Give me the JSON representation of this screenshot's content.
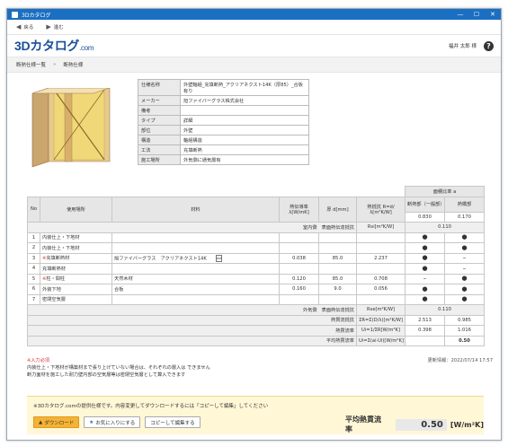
{
  "window": {
    "title": "3Dカタログ",
    "minimize": "—",
    "maximize": "☐",
    "close": "✕"
  },
  "toolbar": {
    "back": "戻る",
    "forward": "進む"
  },
  "header": {
    "logo": "3Dカタログ",
    "logo_suffix": ".com",
    "user": "福井 太郎 様",
    "help": "?"
  },
  "breadcrumb": {
    "item1": "断熱仕様一覧",
    "separator": "»",
    "item2": "断熱仕様"
  },
  "spec": [
    {
      "key": "仕様名称",
      "value": "外壁軸組_充填断熱_アクリアネクスト14K（厚85）_合板有り"
    },
    {
      "key": "メーカー",
      "value": "旭ファイバーグラス株式会社"
    },
    {
      "key": "備考",
      "value": ""
    },
    {
      "key": "タイプ",
      "value": "詳細"
    },
    {
      "key": "部位",
      "value": "外壁"
    },
    {
      "key": "構造",
      "value": "軸組構造"
    },
    {
      "key": "工法",
      "value": "充填断熱"
    },
    {
      "key": "施工場所",
      "value": "外気側に通気層有"
    }
  ],
  "table": {
    "head": {
      "ratio_group": "面積比率 a",
      "no": "No",
      "location": "使用場所",
      "material": "材料",
      "conductivity": "熱伝導率 λ[W/mK]",
      "thickness": "厚 d[mm]",
      "resistance": "熱抵抗 R=d/λ[m²K/W]",
      "part_a": "断熱部（一般部）",
      "part_b": "熱橋部",
      "ratio_a": "0.830",
      "ratio_b": "0.170"
    },
    "indoor": {
      "label": "室内側　表面熱伝達抵抗",
      "symbol": "Rsi[m²K/W]",
      "value": "0.110"
    },
    "rows": [
      {
        "no": "1",
        "mark": "",
        "loc": "内装仕上・下地材",
        "mat": "",
        "pdf": "",
        "lam": "",
        "d": "",
        "r": "",
        "a": "●",
        "b": "●"
      },
      {
        "no": "2",
        "mark": "",
        "loc": "内装仕上・下地材",
        "mat": "",
        "pdf": "",
        "lam": "",
        "d": "",
        "r": "",
        "a": "●",
        "b": "●"
      },
      {
        "no": "3",
        "mark": "※",
        "loc": "充填断熱材",
        "mat": "旭ファイバーグラス　アクリアネクスト14K",
        "pdf": "PDF",
        "lam": "0.038",
        "d": "85.0",
        "r": "2.237",
        "a": "●",
        "b": "–"
      },
      {
        "no": "4",
        "mark": "",
        "loc": "充填断熱材",
        "mat": "",
        "pdf": "",
        "lam": "",
        "d": "",
        "r": "",
        "a": "●",
        "b": "–"
      },
      {
        "no": "5",
        "mark": "※",
        "loc": "柱・間柱",
        "mat": "天然木材",
        "pdf": "",
        "lam": "0.120",
        "d": "85.0",
        "r": "0.708",
        "a": "–",
        "b": "●"
      },
      {
        "no": "6",
        "mark": "",
        "loc": "外装下地",
        "mat": "合板",
        "pdf": "",
        "lam": "0.160",
        "d": "9.0",
        "r": "0.056",
        "a": "●",
        "b": "●"
      },
      {
        "no": "7",
        "mark": "",
        "loc": "密閉空気層",
        "mat": "",
        "pdf": "",
        "lam": "",
        "d": "",
        "r": "",
        "a": "●",
        "b": "●"
      }
    ],
    "outdoor": {
      "label": "外気側　表面熱伝達抵抗",
      "symbol": "Rse[m²K/W]",
      "value": "0.110"
    },
    "totals": [
      {
        "label": "熱貫流抵抗",
        "symbol": "ΣR=Σ(D/λ)[m²K/W]",
        "a": "2.513",
        "b": "0.985"
      },
      {
        "label": "熱貫流率",
        "symbol": "Ui=1/ΣR[W/m²K]",
        "a": "0.398",
        "b": "1.016"
      },
      {
        "label": "平均熱貫流率",
        "symbol": "Ui=Σ(ai·Ui)[W/m²K]",
        "a": "",
        "b": "0.50"
      }
    ]
  },
  "notes": {
    "required": "※入力必須",
    "line1": "内装仕上・下地材が構築材まで張り上げていない場合は、それぞれの層入は できません",
    "line2": "断力面材を施工した耐力壁内部の空気層等は密閉空気層として算入できます"
  },
  "updated": "更新情報：2022/07/14 17:57",
  "bottom": {
    "message": "※3Dカタログ.comの提供仕様です。内容変更してダウンロードするには「コピーして編集」してください",
    "download": "ダウンロード",
    "favorite": "お気に入りにする",
    "copy_edit": "コピーして編集する",
    "avg_label": "平均熱貫流率",
    "avg_value": "0.50",
    "avg_unit": "[W/m²K]"
  },
  "colors": {
    "titlebar": "#1b6fc2",
    "logo": "#1a4e9c",
    "download_button": "#f5b335",
    "bottom_bg": "#fff7d6"
  }
}
